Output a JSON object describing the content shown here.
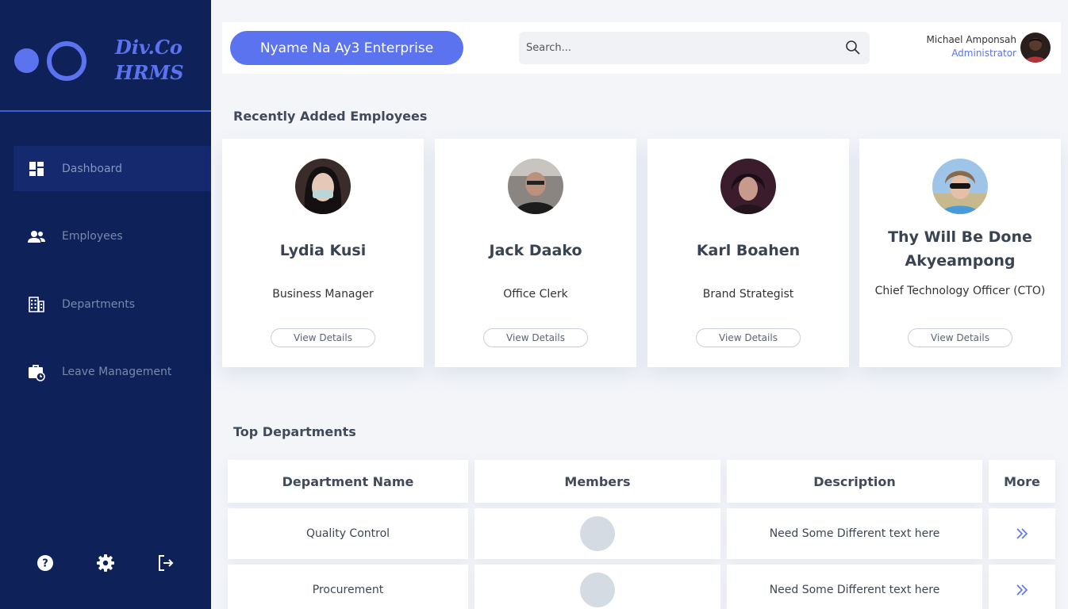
{
  "brand": {
    "line1": "Div.Co",
    "line2": "HRMS"
  },
  "nav": {
    "items": [
      {
        "label": "Dashboard",
        "icon": "dashboard-icon",
        "active": true
      },
      {
        "label": "Employees",
        "icon": "users-icon",
        "active": false
      },
      {
        "label": "Departments",
        "icon": "building-icon",
        "active": false
      },
      {
        "label": "Leave Management",
        "icon": "briefcase-clock-icon",
        "active": false
      }
    ],
    "bottom": [
      "help-icon",
      "settings-icon",
      "logout-icon"
    ]
  },
  "header": {
    "company": "Nyame Na Ay3 Enterprise",
    "search_placeholder": "Search...",
    "user_name": "Michael Amponsah",
    "user_role": "Administrator"
  },
  "recent": {
    "title": "Recently Added Employees",
    "employees": [
      {
        "name": "Lydia Kusi",
        "role": "Business Manager",
        "button": "View Details"
      },
      {
        "name": "Jack Daako",
        "role": "Office Clerk",
        "button": "View Details"
      },
      {
        "name": "Karl Boahen",
        "role": "Brand Strategist",
        "button": "View Details"
      },
      {
        "name": "Thy Will Be Done Akyeampong",
        "role": "Chief Technology Officer (CTO)",
        "button": "View Details"
      }
    ]
  },
  "departments": {
    "title": "Top Departments",
    "columns": [
      "Department Name",
      "Members",
      "Description",
      "More"
    ],
    "rows": [
      {
        "name": "Quality Control",
        "description": "Need Some Different text here"
      },
      {
        "name": "Procurement",
        "description": "Need Some Different text here"
      }
    ]
  },
  "colors": {
    "sidebar": "#0f2159",
    "accent": "#5b73ee",
    "background": "#f3f5f9"
  }
}
